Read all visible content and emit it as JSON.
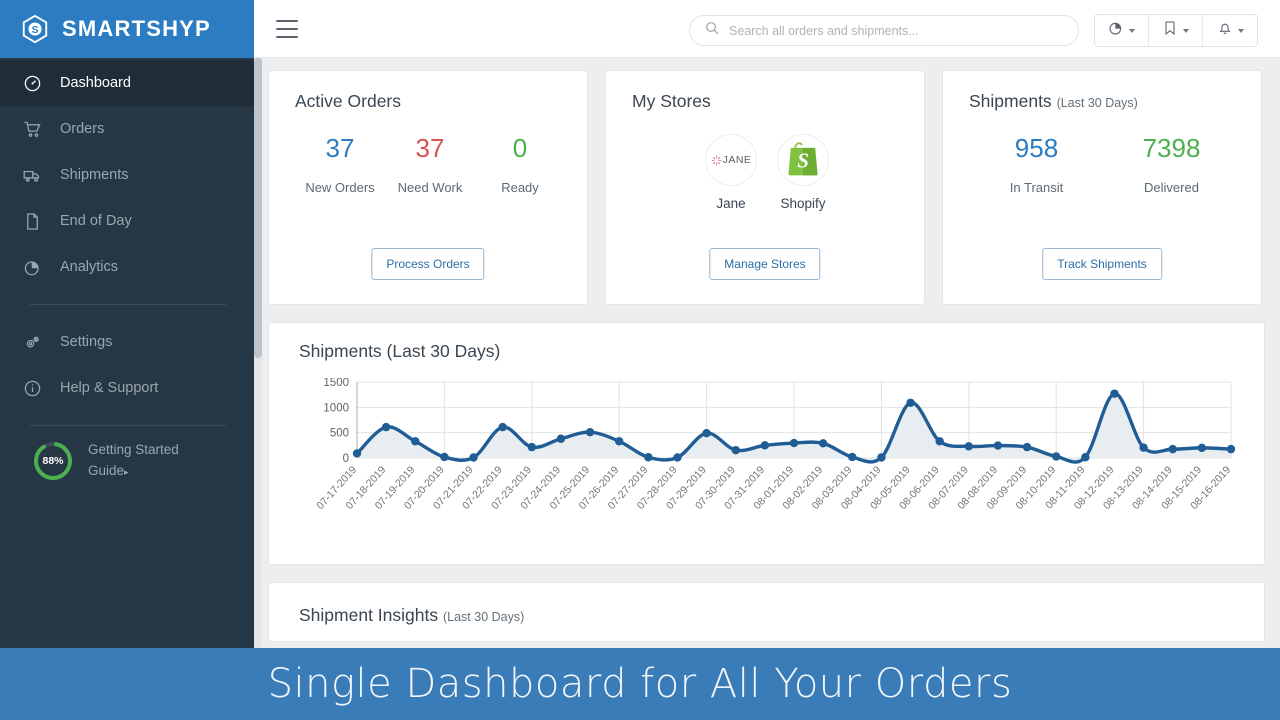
{
  "brand": {
    "name": "SMARTSHYP",
    "logo_icon": "hexagon-s-logo",
    "bg_color": "#2b7cc0"
  },
  "sidebar": {
    "items": [
      {
        "label": "Dashboard",
        "icon": "speedometer-icon",
        "active": true
      },
      {
        "label": "Orders",
        "icon": "shopping-cart-icon",
        "active": false
      },
      {
        "label": "Shipments",
        "icon": "truck-icon",
        "active": false
      },
      {
        "label": "End of Day",
        "icon": "document-icon",
        "active": false
      },
      {
        "label": "Analytics",
        "icon": "pie-chart-icon",
        "active": false
      },
      {
        "label": "Settings",
        "icon": "gears-icon",
        "active": false
      },
      {
        "label": "Help & Support",
        "icon": "info-circle-icon",
        "active": false
      }
    ],
    "getting_started": {
      "percent": "88%",
      "percent_value": 88,
      "line1": "Getting Started",
      "line2": "Guide",
      "caret": "▸",
      "ring_color": "#4caf50"
    }
  },
  "topbar": {
    "menu_icon": "hamburger-menu-icon",
    "search": {
      "placeholder": "Search all orders and shipments...",
      "value": "",
      "icon": "search-icon"
    },
    "buttons": [
      {
        "icon": "pie-chart-icon",
        "caret": "chevron-down-icon"
      },
      {
        "icon": "bookmark-icon",
        "caret": "chevron-down-icon"
      },
      {
        "icon": "bell-icon",
        "caret": "chevron-down-icon"
      }
    ]
  },
  "cards": {
    "active_orders": {
      "title": "Active Orders",
      "stats": [
        {
          "value": "37",
          "label": "New Orders",
          "color": "#2b7cc0"
        },
        {
          "value": "37",
          "label": "Need Work",
          "color": "#d9534f"
        },
        {
          "value": "0",
          "label": "Ready",
          "color": "#4caf50"
        }
      ],
      "button": "Process Orders"
    },
    "my_stores": {
      "title": "My Stores",
      "stores": [
        {
          "name": "Jane",
          "icon": "jane-store-logo"
        },
        {
          "name": "Shopify",
          "icon": "shopify-bag-logo"
        }
      ],
      "button": "Manage Stores"
    },
    "shipments": {
      "title": "Shipments",
      "subtitle": "(Last 30 Days)",
      "stats": [
        {
          "value": "958",
          "label": "In Transit",
          "color": "#2b7cc0"
        },
        {
          "value": "7398",
          "label": "Delivered",
          "color": "#4caf50"
        }
      ],
      "button": "Track Shipments"
    }
  },
  "chart_card": {
    "title": "Shipments (Last 30 Days)"
  },
  "insights_card": {
    "title": "Shipment Insights",
    "subtitle": "(Last 30 Days)"
  },
  "banner": {
    "text": "Single Dashboard for All Your Orders",
    "bg_color": "#3a7cb8"
  },
  "chart_data": {
    "type": "area",
    "title": "Shipments (Last 30 Days)",
    "xlabel": "",
    "ylabel": "",
    "ylim": [
      0,
      1500
    ],
    "yticks": [
      0,
      500,
      1000,
      1500
    ],
    "grid": true,
    "legend": false,
    "line_color": "#1f5d94",
    "fill_color": "#e8edf1",
    "categories": [
      "07-17-2019",
      "07-18-2019",
      "07-19-2019",
      "07-20-2019",
      "07-21-2019",
      "07-22-2019",
      "07-23-2019",
      "07-24-2019",
      "07-25-2019",
      "07-26-2019",
      "07-27-2019",
      "07-28-2019",
      "07-29-2019",
      "07-30-2019",
      "07-31-2019",
      "08-01-2019",
      "08-02-2019",
      "08-03-2019",
      "08-04-2019",
      "08-05-2019",
      "08-06-2019",
      "08-07-2019",
      "08-08-2019",
      "08-09-2019",
      "08-10-2019",
      "08-11-2019",
      "08-12-2019",
      "08-13-2019",
      "08-14-2019",
      "08-15-2019",
      "08-16-2019"
    ],
    "values": [
      90,
      610,
      330,
      20,
      10,
      610,
      215,
      380,
      510,
      330,
      15,
      10,
      490,
      155,
      250,
      295,
      290,
      20,
      10,
      1090,
      330,
      230,
      245,
      215,
      30,
      15,
      1270,
      205,
      175,
      200,
      175
    ]
  }
}
